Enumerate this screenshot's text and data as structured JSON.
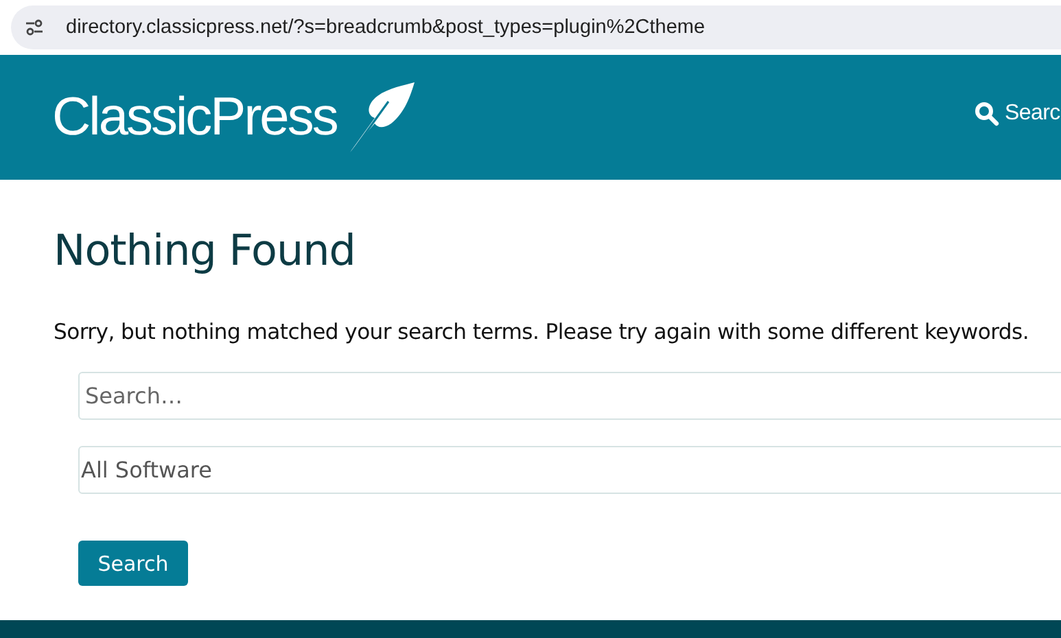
{
  "address_bar": {
    "url": "directory.classicpress.net/?s=breadcrumb&post_types=plugin%2Ctheme"
  },
  "header": {
    "logo": "ClassicPress",
    "nav_search": "Searc"
  },
  "main": {
    "title": "Nothing Found",
    "message": "Sorry, but nothing matched your search terms. Please try again with some different keywords.",
    "search_field": {
      "placeholder": "Search…"
    },
    "type_select": {
      "value": "All Software"
    },
    "submit": "Search"
  }
}
